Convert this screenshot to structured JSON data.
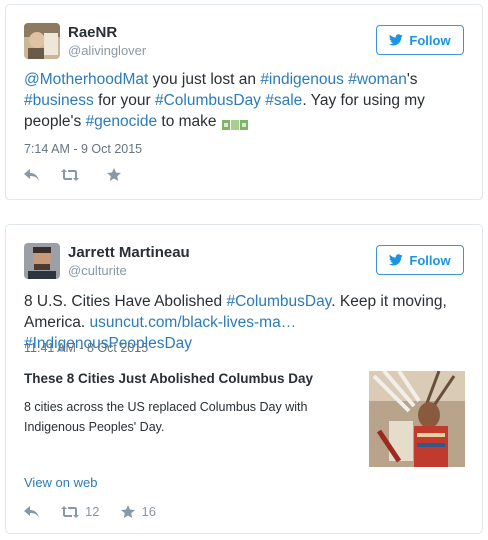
{
  "tweets": [
    {
      "name": "RaeNR",
      "handle": "@alivinglover",
      "follow_label": "Follow",
      "text_parts": [
        {
          "t": "@MotherhoodMat",
          "link": true
        },
        {
          "t": " you just lost an ",
          "link": false
        },
        {
          "t": "#indigenous",
          "link": true
        },
        {
          "t": " ",
          "link": false
        },
        {
          "t": "#woman",
          "link": true
        },
        {
          "t": "'s ",
          "link": false
        },
        {
          "t": "#business",
          "link": true
        },
        {
          "t": " for your ",
          "link": false
        },
        {
          "t": "#ColumbusDay",
          "link": true
        },
        {
          "t": " ",
          "link": false
        },
        {
          "t": "#sale",
          "link": true
        },
        {
          "t": ". Yay for using my people's ",
          "link": false
        },
        {
          "t": "#genocide",
          "link": true
        },
        {
          "t": " to make ",
          "link": false
        }
      ],
      "timestamp": "7:14 AM - 9 Oct 2015",
      "retweet_count": "",
      "like_count": ""
    },
    {
      "name": "Jarrett Martineau",
      "handle": "@culturite",
      "follow_label": "Follow",
      "text_parts": [
        {
          "t": "8 U.S. Cities Have Abolished ",
          "link": false
        },
        {
          "t": "#ColumbusDay",
          "link": true
        },
        {
          "t": ". Keep it moving, America. ",
          "link": false
        },
        {
          "t": "usuncut.com/black-lives-ma…",
          "link": true
        },
        {
          "t": " ",
          "link": false
        },
        {
          "t": "#IndigenousPeoplesDay",
          "link": true
        }
      ],
      "timestamp": "11:41 AM - 8 Oct 2015",
      "card": {
        "title": "These 8 Cities Just Abolished Columbus Day",
        "description": "8 cities across the US replaced Columbus Day with Indigenous Peoples' Day.",
        "view_on_web": "View on web"
      },
      "retweet_count": "12",
      "like_count": "16"
    }
  ],
  "colors": {
    "link": "#2b7bb9",
    "border": "#e1e8ed",
    "muted": "#8899a6",
    "follow_blue": "#1b95e0"
  }
}
